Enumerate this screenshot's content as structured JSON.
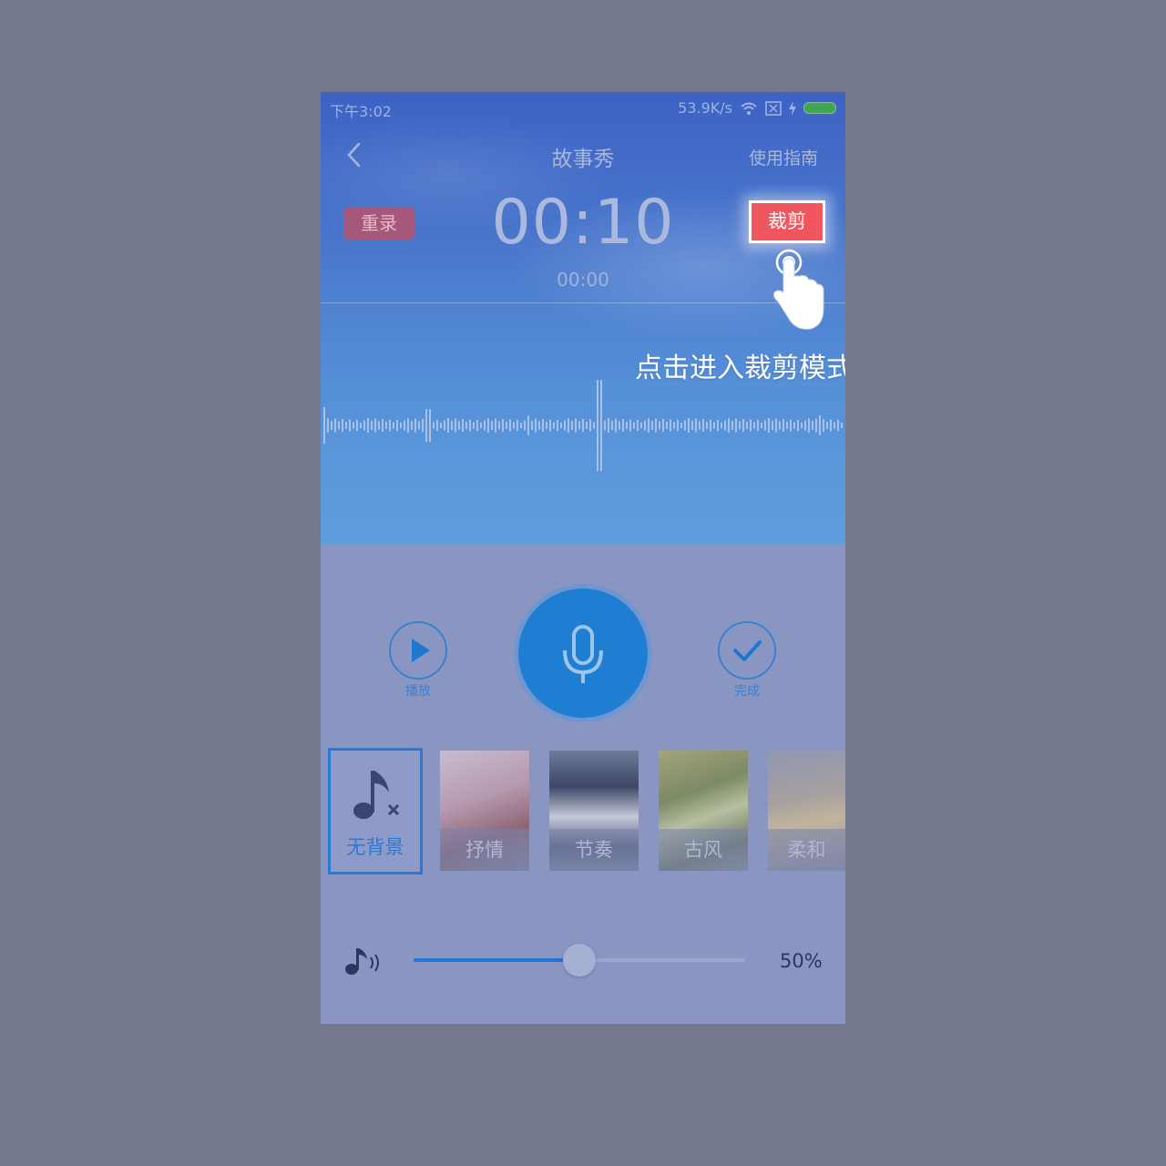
{
  "status_bar": {
    "time": "下午3:02",
    "network_speed": "53.9K/s"
  },
  "navbar": {
    "title": "故事秀",
    "guide": "使用指南",
    "back_icon": "chevron-left-icon"
  },
  "recorder": {
    "rerecord_label": "重录",
    "timer": "00:10",
    "timer_sub": "00:00",
    "crop_label": "裁剪"
  },
  "tutorial": {
    "hint": "点击进入裁剪模式",
    "pointer_icon": "tap-hand-icon"
  },
  "controls": {
    "play_label": "播放",
    "done_label": "完成",
    "play_icon": "play-icon",
    "mic_icon": "microphone-icon",
    "done_icon": "check-icon"
  },
  "backgrounds": [
    {
      "label": "无背景",
      "selected": true,
      "icon": "music-note-off-icon"
    },
    {
      "label": "抒情",
      "selected": false
    },
    {
      "label": "节奏",
      "selected": false
    },
    {
      "label": "古风",
      "selected": false
    },
    {
      "label": "柔和",
      "selected": false
    }
  ],
  "volume": {
    "value_text": "50%",
    "level": 0.5,
    "icon": "volume-note-icon"
  },
  "colors": {
    "accent": "#1e7fd2",
    "crop_button": "#f0565e",
    "rerecord_button": "#a6587a",
    "overlay": "#74788f"
  }
}
